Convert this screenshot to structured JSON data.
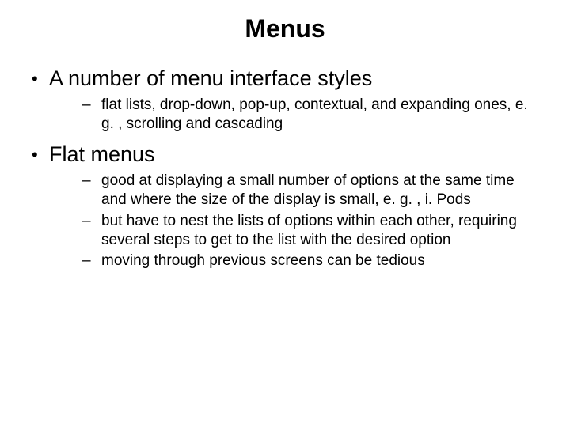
{
  "title": "Menus",
  "bullets": [
    {
      "text": "A number of menu interface styles",
      "sub": [
        "flat lists, drop-down, pop-up, contextual, and expanding ones, e. g. , scrolling and cascading"
      ]
    },
    {
      "text": "Flat menus",
      "sub": [
        "good at displaying a small number of options at the same time and where the size of the display is small, e. g. , i. Pods",
        "but have to nest the lists of options within each other, requiring several steps to get to the list with the desired option",
        "moving through previous screens can be tedious"
      ]
    }
  ]
}
